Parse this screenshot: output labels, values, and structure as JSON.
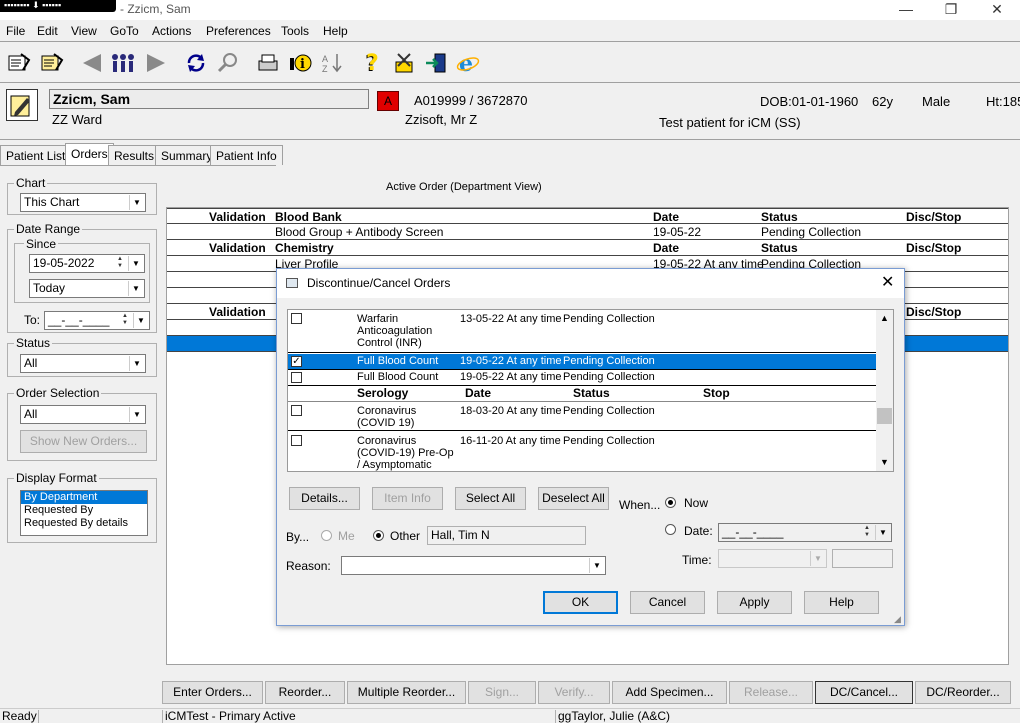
{
  "window": {
    "title": "- Zzicm, Sam",
    "badge": "▪▪▪▪▪▪▪▪ ⬇ ▪▪▪▪▪▪",
    "minimize": "—",
    "maximize": "❐",
    "close": "✕"
  },
  "menu": [
    "File",
    "Edit",
    "View",
    "GoTo",
    "Actions",
    "Preferences",
    "Tools",
    "Help"
  ],
  "toolbar": {
    "icons": [
      "patients-icon",
      "patient-list-icon",
      "back-icon",
      "people-icon",
      "forward-icon",
      "refresh-icon",
      "search-icon",
      "print-icon",
      "info-icon",
      "sort-icon",
      "help-icon",
      "tools-icon",
      "exit-icon",
      "ie-icon"
    ]
  },
  "patient": {
    "name": "Zzicm, Sam",
    "ward": "ZZ Ward",
    "alert": "A",
    "id": "A019999 / 3672870",
    "consultant": "Zzisoft, Mr Z",
    "dob": "DOB:01-01-1960",
    "age": "62y",
    "sex": "Male",
    "height": "Ht:185",
    "note": "Test patient for iCM (SS)"
  },
  "tabs": [
    "Patient List",
    "Orders",
    "Results",
    "Summary",
    "Patient Info"
  ],
  "left": {
    "chart": {
      "label": "Chart",
      "value": "This Chart"
    },
    "date_range": {
      "label": "Date Range",
      "since_label": "Since",
      "since_date": "19-05-2022",
      "since_preset": "Today",
      "to_label": "To:",
      "to_value": "__-__-____"
    },
    "status": {
      "label": "Status",
      "value": "All"
    },
    "order_selection": {
      "label": "Order Selection",
      "value": "All",
      "show_new": "Show New Orders..."
    },
    "display_format": {
      "label": "Display Format",
      "options": [
        "By Department",
        "Requested By",
        "Requested By details"
      ]
    }
  },
  "main": {
    "title": "Active Order (Department View)",
    "headers": {
      "validation": "Validation",
      "date": "Date",
      "status": "Status",
      "disc": "Disc/Stop"
    },
    "sections": [
      {
        "dept": "Blood Bank",
        "rows": [
          {
            "name": "Blood Group + Antibody Screen",
            "date": "19-05-22",
            "status": "Pending Collection"
          }
        ]
      },
      {
        "dept": "Chemistry",
        "rows": [
          {
            "name": "Liver Profile",
            "date": "19-05-22 At any time",
            "status": "Pending Collection"
          }
        ]
      }
    ]
  },
  "dialog": {
    "title": "Discontinue/Cancel Orders",
    "rows": [
      {
        "name": "Warfarin Anticoagulation Control (INR)",
        "date": "13-05-22 At any time",
        "status": "Pending Collection",
        "checked": ""
      },
      {
        "name": "Full Blood Count",
        "date": "19-05-22 At any time",
        "status": "Pending Collection",
        "checked": "✓"
      },
      {
        "name": "Full Blood Count",
        "date": "19-05-22 At any time",
        "status": "Pending Collection",
        "checked": ""
      }
    ],
    "serology_header": {
      "dept": "Serology",
      "date": "Date",
      "status": "Status",
      "stop": "Stop"
    },
    "serology_rows": [
      {
        "name": "Coronavirus (COVID 19)",
        "date": "18-03-20 At any time",
        "status": "Pending Collection"
      },
      {
        "name": "Coronavirus (COVID-19) Pre-Op / Asymptomatic",
        "date": "16-11-20 At any time",
        "status": "Pending Collection"
      }
    ],
    "buttons": {
      "details": "Details...",
      "item_info": "Item Info",
      "select_all": "Select All",
      "deselect_all": "Deselect All",
      "ok": "OK",
      "cancel": "Cancel",
      "apply": "Apply",
      "help": "Help"
    },
    "when_label": "When...",
    "now_label": "Now",
    "date_label": "Date:",
    "date_value": "__-__-____",
    "time_label": "Time:",
    "by_label": "By...",
    "me_label": "Me",
    "other_label": "Other",
    "other_value": "Hall, Tim N",
    "reason_label": "Reason:"
  },
  "bottom_buttons": [
    {
      "label": "Enter Orders...",
      "disabled": false
    },
    {
      "label": "Reorder...",
      "disabled": false
    },
    {
      "label": "Multiple Reorder...",
      "disabled": false
    },
    {
      "label": "Sign...",
      "disabled": true
    },
    {
      "label": "Verify...",
      "disabled": true
    },
    {
      "label": "Add Specimen...",
      "disabled": false
    },
    {
      "label": "Release...",
      "disabled": true
    },
    {
      "label": "DC/Cancel...",
      "disabled": false
    },
    {
      "label": "DC/Reorder...",
      "disabled": false
    }
  ],
  "status": {
    "ready": "Ready",
    "env": "iCMTest - Primary Active",
    "user": "ggTaylor, Julie  (A&C)"
  }
}
